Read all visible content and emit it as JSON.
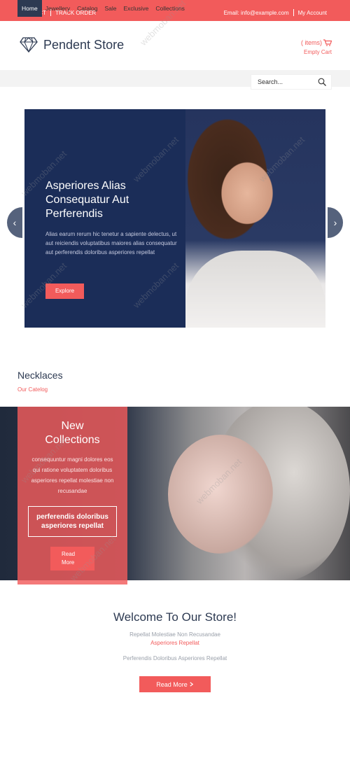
{
  "topbar": {
    "contact": "CONTACT",
    "track_order": "TRACK ORDER",
    "email": "Email: info@example.com",
    "my_account": "My Account"
  },
  "header": {
    "logo_icon": "diamond-icon",
    "store_name": "Pendent Store",
    "cart_items": "( items)",
    "cart_icon": "cart-icon",
    "cart_status": "Empty Cart"
  },
  "nav": {
    "items": [
      {
        "label": "Home",
        "active": true
      },
      {
        "label": "Jewellery"
      },
      {
        "label": "Catalog"
      },
      {
        "label": "Sale"
      },
      {
        "label": "Exclusive"
      },
      {
        "label": "Collections"
      }
    ],
    "search_placeholder": "Search..."
  },
  "hero": {
    "title": "Asperiores Alias Consequatur Aut Perferendis",
    "text": "Alias earum rerum hic tenetur a sapiente delectus, ut aut reiciendis voluptatibus maiores alias consequatur aut perferendis doloribus asperiores repellat",
    "button": "Explore",
    "prev": "‹",
    "next": "›"
  },
  "section": {
    "title": "Necklaces",
    "subtitle": "Our Catelog"
  },
  "collection": {
    "title_line1": "New",
    "title_line2": "Collections",
    "text": "consequuntur magni dolores eos qui ratione voluptatem doloribus asperiores repellat molestiae non recusandae",
    "box_text": "perferendis doloribus asperiores repellat",
    "read_line1": "Read",
    "read_line2": "More"
  },
  "welcome": {
    "title": "Welcome To Our Store!",
    "line1": "Repellat Molestiae Non Recusandae",
    "line2": "Asperiores Repellat",
    "line3": "Perferendis Doloribus Asperiores Repellat",
    "button": "Read More",
    "button_icon": "chevron-right-icon"
  },
  "watermark": "webmoban.net",
  "colors": {
    "accent": "#f25b5b",
    "navy": "#2d3a52",
    "hero_bg": "#1b2d58"
  }
}
